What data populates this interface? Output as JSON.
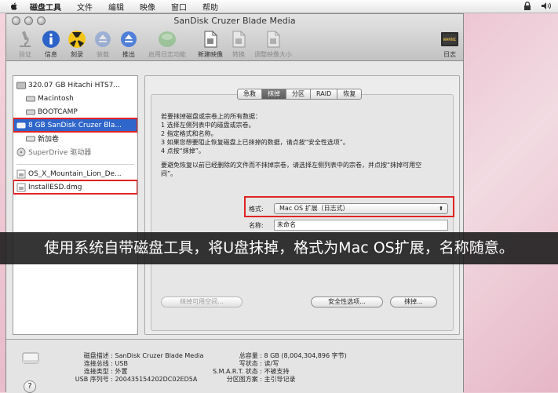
{
  "menubar": {
    "items": [
      "磁盘工具",
      "文件",
      "编辑",
      "映像",
      "窗口",
      "帮助"
    ]
  },
  "window": {
    "title": "SanDisk Cruzer Blade Media"
  },
  "toolbar": {
    "buttons": [
      {
        "label": "验证",
        "icon": "microscope-icon",
        "enabled": false
      },
      {
        "label": "信息",
        "icon": "info-icon",
        "enabled": true
      },
      {
        "label": "刻录",
        "icon": "burn-icon",
        "enabled": true
      },
      {
        "label": "装载",
        "icon": "mount-icon",
        "enabled": false
      },
      {
        "label": "推出",
        "icon": "eject-icon",
        "enabled": true
      },
      {
        "label": "启用日志功能",
        "icon": "journal-icon",
        "enabled": false
      },
      {
        "label": "新建映像",
        "icon": "new-image-icon",
        "enabled": true
      },
      {
        "label": "转换",
        "icon": "convert-icon",
        "enabled": false
      },
      {
        "label": "调整映像大小",
        "icon": "resize-image-icon",
        "enabled": false
      }
    ],
    "log_label": "日志",
    "log_icon_text": "WARNI"
  },
  "sidebar": {
    "items": [
      {
        "label": "320.07 GB Hitachi HTS7...",
        "icon": "hard-disk-icon",
        "indent": 0
      },
      {
        "label": "Macintosh",
        "icon": "volume-icon",
        "indent": 1
      },
      {
        "label": "BOOTCAMP",
        "icon": "volume-icon",
        "indent": 1
      },
      {
        "label": "8 GB SanDisk Cruzer Bla...",
        "icon": "usb-drive-icon",
        "indent": 0,
        "selected": true
      },
      {
        "label": "新加卷",
        "icon": "volume-icon",
        "indent": 1
      },
      {
        "label": "SuperDrive 驱动器",
        "icon": "optical-drive-icon",
        "indent": 0,
        "dim": true
      },
      {
        "label": "OS_X_Mountain_Lion_De...",
        "icon": "dmg-icon",
        "indent": 0
      },
      {
        "label": "InstallESD.dmg",
        "icon": "dmg-icon",
        "indent": 0
      }
    ]
  },
  "tabs": [
    "急救",
    "抹掉",
    "分区",
    "RAID",
    "恢复"
  ],
  "erase": {
    "instructions": [
      "若要抹掉磁盘或宗卷上的所有数据：",
      "1 选择左侧列表中的磁盘或宗卷。",
      "2 指定格式和名称。",
      "3 如果您想要阻止恢复磁盘上已抹掉的数据，请点按“安全性选项”。",
      "4 点按“抹掉”。"
    ],
    "note_line1": "要避免恢复以前已经删除的文件而不抹掉宗卷，请选择左侧列表中的宗卷，并点按“抹掉可用空",
    "note_line2": "间”。",
    "format_label": "格式:",
    "format_value": "Mac OS 扩展（日志式）",
    "name_label": "名称:",
    "name_value": "未命名",
    "erase_free_space_btn": "抹掉可用空间...",
    "security_options_btn": "安全性选项...",
    "erase_btn": "抹掉..."
  },
  "info": {
    "left": [
      {
        "k": "磁盘描述 :",
        "v": "SanDisk Cruzer Blade Media"
      },
      {
        "k": "连接总线 :",
        "v": "USB"
      },
      {
        "k": "连接类型 :",
        "v": "外置"
      },
      {
        "k": "USB 序列号 :",
        "v": "200435154202DC02ED5A"
      }
    ],
    "right": [
      {
        "k": "总容量 :",
        "v": "8 GB (8,004,304,896 字节)"
      },
      {
        "k": "写状态 :",
        "v": "读/写"
      },
      {
        "k": "S.M.A.R.T. 状态 :",
        "v": "不被支持"
      },
      {
        "k": "分区图方案 :",
        "v": "主引导记录"
      }
    ],
    "help": "?"
  },
  "caption": "使用系统自带磁盘工具，将U盘抹掉，格式为Mac OS扩展，名称随意。",
  "colors": {
    "highlight": "#e12323",
    "selection": "#2f66c9"
  }
}
